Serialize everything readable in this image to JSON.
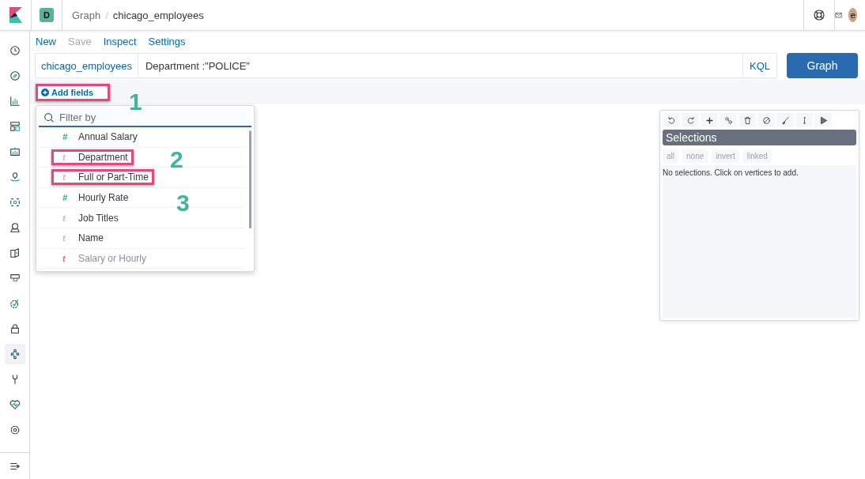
{
  "header": {
    "space_badge": "D",
    "breadcrumbs": [
      "Graph",
      "chicago_employees"
    ],
    "breadcrumb_separator": "/",
    "avatar": "e"
  },
  "sidebar": {
    "items": [
      {
        "selected": false
      },
      {
        "selected": false
      },
      {
        "selected": false
      },
      {
        "selected": false
      },
      {
        "selected": false
      },
      {
        "selected": false
      },
      {
        "selected": false
      },
      {
        "selected": false
      },
      {
        "selected": false
      },
      {
        "selected": false
      },
      {
        "selected": false
      },
      {
        "selected": false
      },
      {
        "selected": true
      },
      {
        "selected": false
      },
      {
        "selected": false
      },
      {
        "selected": false
      }
    ]
  },
  "menu": [
    {
      "label": "New",
      "disabled": false
    },
    {
      "label": "Save",
      "disabled": true
    },
    {
      "label": "Inspect",
      "disabled": false
    },
    {
      "label": "Settings",
      "disabled": false
    }
  ],
  "query_bar": {
    "index": "chicago_employees",
    "query": "Department :\"POLICE\"",
    "language": "KQL",
    "submit": "Graph"
  },
  "add_fields": {
    "label": "Add fields",
    "highlighted": true
  },
  "field_picker": {
    "placeholder": "Filter by",
    "fields": [
      {
        "glyph": "#",
        "kind": "number",
        "label": "Annual Salary",
        "highlighted": false
      },
      {
        "glyph": "t",
        "kind": "string",
        "label": "Department",
        "highlighted": true
      },
      {
        "glyph": "t",
        "kind": "string",
        "label": "Full or Part-Time",
        "highlighted": true
      },
      {
        "glyph": "#",
        "kind": "number",
        "label": "Hourly Rate",
        "highlighted": false
      },
      {
        "glyph": "t",
        "kind": "string",
        "label": "Job Titles",
        "highlighted": false
      },
      {
        "glyph": "t",
        "kind": "string",
        "label": "Name",
        "highlighted": false
      },
      {
        "glyph": "t",
        "kind": "string",
        "label": "Salary or Hourly",
        "highlighted": false
      }
    ]
  },
  "callouts": [
    "1",
    "2",
    "3"
  ],
  "selections_panel": {
    "title": "Selections",
    "buttons": [
      "all",
      "none",
      "invert",
      "linked"
    ],
    "message": "No selections. Click on vertices to add."
  }
}
